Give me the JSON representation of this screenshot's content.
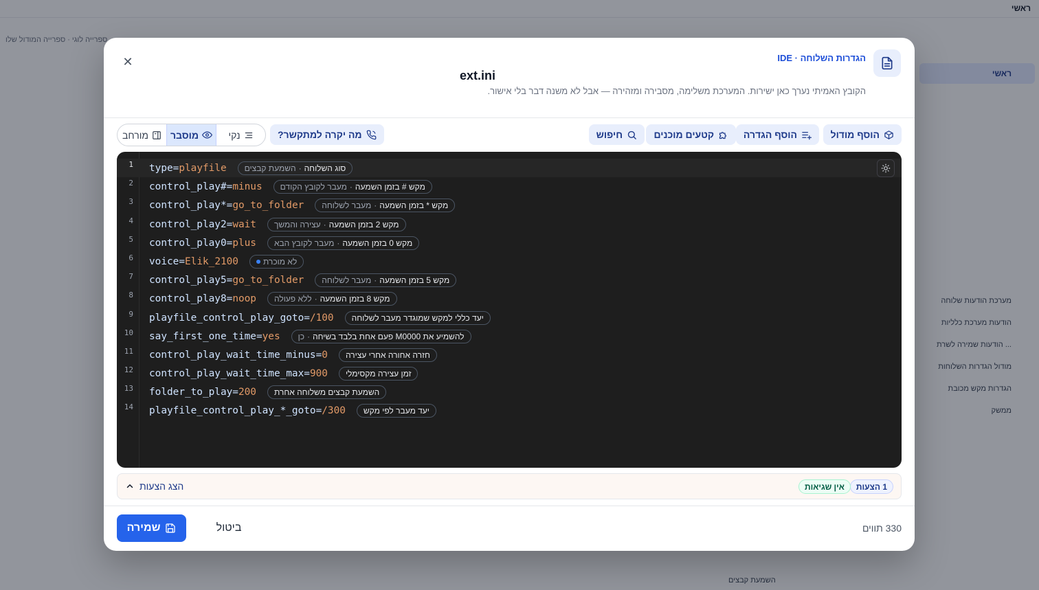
{
  "background": {
    "title": "ראשי",
    "breadcrumb": "ספרייה לוגי · ספרייה המודול שלו",
    "side_items": [
      "ראשי",
      "מערכת הודעות שלוחה",
      "הודעות מערכת כלליות",
      "הודעות שמירה לשרת ...",
      "מודול הגדרות השלוחות",
      "הגדרות מקש מכובת",
      "ממשק"
    ],
    "footer": "השמעת קבצים"
  },
  "modal": {
    "eyebrow": "הגדרות השלוחה · IDE",
    "file_title": "ext.ini",
    "subtitle": "הקובץ האמיתי נערך כאן ישירות. המערכת משלימה, מסבירה ומזהירה — אבל לא משנה דבר בלי אישור.",
    "toolbar": {
      "add_module": "הוסף מודול",
      "add_setting": "הוסף הגדרה",
      "snippets": "קטעים מוכנים",
      "search": "חיפוש",
      "caller_preview": "מה יקרה למתקשר?"
    },
    "view_modes": {
      "clean": "נקי",
      "explained": "מוסבר",
      "expanded": "מורחב"
    },
    "code_lines": [
      {
        "n": "1",
        "key": "type",
        "value": "playfile",
        "hint": "סוג השלוחה",
        "hint_sub": "השמעת קבצים"
      },
      {
        "n": "2",
        "key": "control_play#",
        "value": "minus",
        "hint": "מקש # בזמן השמעה",
        "hint_sub": "מעבר לקובץ הקודם"
      },
      {
        "n": "3",
        "key": "control_play*",
        "value": "go_to_folder",
        "hint": "מקש * בזמן השמעה",
        "hint_sub": "מעבר לשלוחה"
      },
      {
        "n": "4",
        "key": "control_play2",
        "value": "wait",
        "hint": "מקש 2 בזמן השמעה",
        "hint_sub": "עצירה והמשך"
      },
      {
        "n": "5",
        "key": "control_play0",
        "value": "plus",
        "hint": "מקש 0 בזמן השמעה",
        "hint_sub": "מעבר לקובץ הבא"
      },
      {
        "n": "6",
        "key": "voice",
        "value": "Elik_2100",
        "hint": "",
        "hint_sub": "לא מוכרת",
        "unknown": true
      },
      {
        "n": "7",
        "key": "control_play5",
        "value": "go_to_folder",
        "hint": "מקש 5 בזמן השמעה",
        "hint_sub": "מעבר לשלוחה"
      },
      {
        "n": "8",
        "key": "control_play8",
        "value": "noop",
        "hint": "מקש 8 בזמן השמעה",
        "hint_sub": "ללא פעולה"
      },
      {
        "n": "9",
        "key": "playfile_control_play_goto",
        "value": "/100",
        "hint": "יעד כללי למקש שמוגדר מעבר לשלוחה",
        "hint_sub": ""
      },
      {
        "n": "10",
        "key": "say_first_one_time",
        "value": "yes",
        "hint": "להשמיע את M0000 פעם אחת בלבד בשיחה",
        "hint_sub": "כן"
      },
      {
        "n": "11",
        "key": "control_play_wait_time_minus",
        "value": "0",
        "hint": "חזרה אחורה אחרי עצירה",
        "hint_sub": ""
      },
      {
        "n": "12",
        "key": "control_play_wait_time_max",
        "value": "900",
        "hint": "זמן עצירה מקסימלי",
        "hint_sub": ""
      },
      {
        "n": "13",
        "key": "folder_to_play",
        "value": "200",
        "hint": "השמעת קבצים משלוחה אחרת",
        "hint_sub": ""
      },
      {
        "n": "14",
        "key": "playfile_control_play_*_goto",
        "value": "/300",
        "hint": "יעד מעבר לפי מקש",
        "hint_sub": ""
      }
    ],
    "suggestions": {
      "count_badge": "1 הצעות",
      "status_badge": "אין שגיאות",
      "toggle": "הצג הצעות"
    },
    "footer": {
      "char_count": "330 תווים",
      "cancel": "ביטול",
      "save": "שמירה"
    }
  },
  "colors": {
    "accent": "#2563eb",
    "editor_bg": "#1e1e1e",
    "code_key": "#cfe3ff",
    "code_value": "#e29a67"
  }
}
